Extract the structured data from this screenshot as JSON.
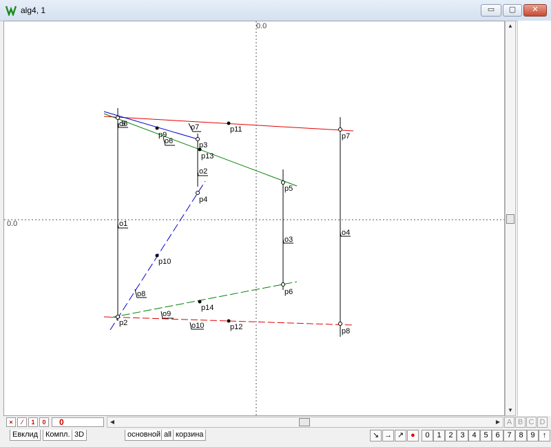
{
  "window": {
    "title": "alg4, 1",
    "minimize": "▭",
    "restore": "▢",
    "close": "✕"
  },
  "axes": {
    "x_origin_label": "0.0",
    "y_origin_label": "0.0"
  },
  "points": [
    {
      "label": "p2"
    },
    {
      "label": "p3"
    },
    {
      "label": "p4"
    },
    {
      "label": "p5"
    },
    {
      "label": "p6"
    },
    {
      "label": "p7"
    },
    {
      "label": "p8"
    },
    {
      "label": "p9"
    },
    {
      "label": "p10"
    },
    {
      "label": "p11"
    },
    {
      "label": "p12"
    },
    {
      "label": "p13"
    },
    {
      "label": "p14"
    }
  ],
  "objects": [
    "o1",
    "o2",
    "o3",
    "o4",
    "o6",
    "o7",
    "o8",
    "o9",
    "o10"
  ],
  "overlap_label": "o6",
  "status": {
    "x_btn": "×",
    "slash_btn": "⁄",
    "one_btn": "1",
    "zero_btn": "0",
    "counter": "0"
  },
  "letters": [
    "A",
    "B",
    "C",
    "D"
  ],
  "tabs_left": [
    "Евклид",
    "Компл.",
    "3D"
  ],
  "tabs_right": [
    "основной",
    "all",
    "корзина"
  ],
  "tools": [
    "↘",
    "→",
    "↗",
    "●"
  ],
  "numbers": [
    "0",
    "1",
    "2",
    "3",
    "4",
    "5",
    "6",
    "7",
    "8",
    "9",
    "↑"
  ],
  "colors": {
    "red": "#e00000",
    "green": "#008000",
    "blue": "#0000d0"
  }
}
